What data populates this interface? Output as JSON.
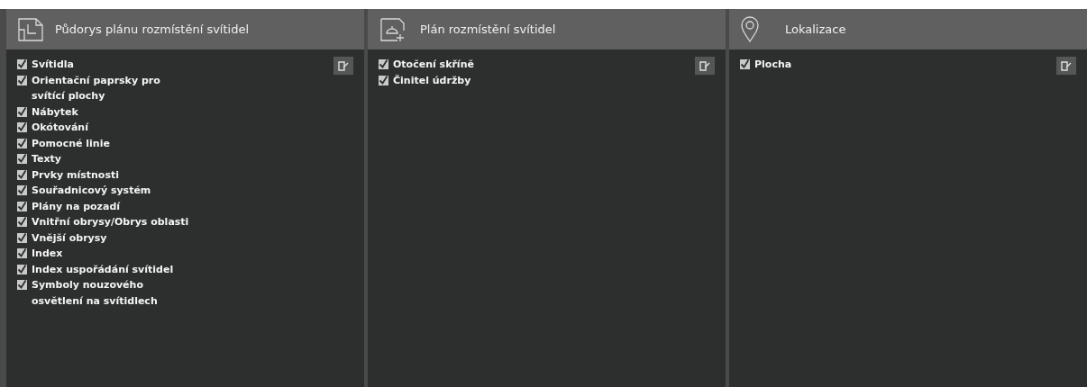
{
  "panels": [
    {
      "title": "Půdorys plánu rozmístění svítidel",
      "kind": "floorplan",
      "items": [
        {
          "label": "Svítidla",
          "checked": true
        },
        {
          "label": "Orientační paprsky pro\nsvítící plochy",
          "checked": true
        },
        {
          "label": "Nábytek",
          "checked": true
        },
        {
          "label": "Okótování",
          "checked": true
        },
        {
          "label": "Pomocné linie",
          "checked": true
        },
        {
          "label": "Texty",
          "checked": true
        },
        {
          "label": "Prvky místnosti",
          "checked": true
        },
        {
          "label": "Souřadnicový systém",
          "checked": true
        },
        {
          "label": "Plány na pozadí",
          "checked": true
        },
        {
          "label": "Vnitřní obrysy/Obrys oblasti",
          "checked": true
        },
        {
          "label": "Vnější obrysy",
          "checked": true
        },
        {
          "label": "Index",
          "checked": true
        },
        {
          "label": "Index uspořádání svítidel",
          "checked": true
        },
        {
          "label": "Symboly nouzového\nosvětlení na svítidlech",
          "checked": true
        }
      ]
    },
    {
      "title": "Plán rozmístění svítidel",
      "kind": "lamp-plan",
      "items": [
        {
          "label": "Otočení skříně",
          "checked": true
        },
        {
          "label": "Činitel údržby",
          "checked": true
        }
      ]
    },
    {
      "title": "Lokalizace",
      "kind": "pin",
      "items": [
        {
          "label": "Plocha",
          "checked": true
        }
      ]
    }
  ]
}
